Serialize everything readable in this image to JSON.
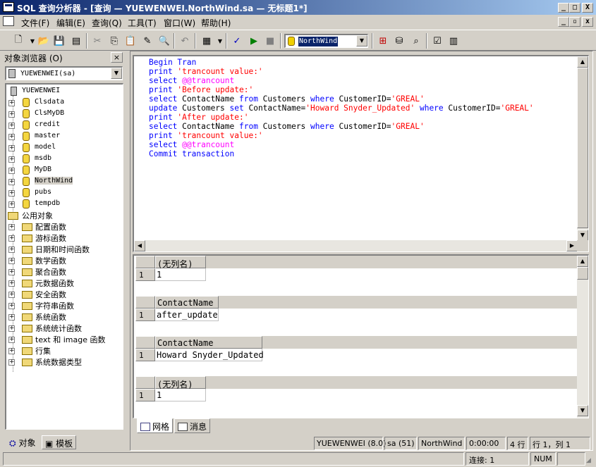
{
  "window": {
    "title": "SQL 查询分析器 - [查询 — YUEWENWEI.NorthWind.sa — 无标题1*]",
    "minimize": "_",
    "maximize": "□",
    "close": "X"
  },
  "menu": {
    "items": [
      "文件(F)",
      "编辑(E)",
      "查询(Q)",
      "工具(T)",
      "窗口(W)",
      "帮助(H)"
    ]
  },
  "toolbar": {
    "database": "NorthWind",
    "icons": [
      "new-query-icon",
      "open-icon",
      "save-icon",
      "load-script-icon",
      "cut-icon",
      "copy-icon",
      "paste-icon",
      "clear-icon",
      "find-icon",
      "undo-icon",
      "results-mode-icon",
      "parse-icon",
      "execute-icon",
      "cancel-icon",
      "database-icon",
      "object-browser-icon",
      "object-search-icon",
      "show-plan-icon",
      "options-icon",
      "results-pane-icon"
    ]
  },
  "object_browser": {
    "title": "对象浏览器 (O)",
    "close": "×",
    "server_selector": "YUEWENWEI(sa)",
    "server": "YUEWENWEI",
    "databases": [
      "Clsdata",
      "ClsMyDB",
      "credit",
      "master",
      "model",
      "msdb",
      "MyDB",
      "NorthWind",
      "pubs",
      "tempdb"
    ],
    "selected_database": "NorthWind",
    "common_objects": {
      "label": "公用对象",
      "items": [
        "配置函数",
        "游标函数",
        "日期和时间函数",
        "数学函数",
        "聚合函数",
        "元数据函数",
        "安全函数",
        "字符串函数",
        "系统函数",
        "系统统计函数",
        "text 和 image 函数",
        "行集",
        "系统数据类型"
      ]
    },
    "tabs": [
      "对象",
      "模板"
    ]
  },
  "editor": {
    "lines": [
      "Begin Tran",
      "print 'trancount value:'",
      "select @@trancount",
      "print 'Before update:'",
      "select ContactName from Customers where CustomerID='GREAL'",
      "update Customers set ContactName='Howard Snyder_Updated' where CustomerID='GREAL'",
      "print 'After update:'",
      "select ContactName from Customers where CustomerID='GREAL'",
      "print 'trancount value:'",
      "select @@trancount",
      "Commit transaction"
    ]
  },
  "results": [
    {
      "column": "(无列名)",
      "row_num": "1",
      "value": "1"
    },
    {
      "column": "ContactName",
      "row_num": "1",
      "value": "after_update"
    },
    {
      "column": "ContactName",
      "row_num": "1",
      "value": "Howard Snyder_Updated"
    },
    {
      "column": "(无列名)",
      "row_num": "1",
      "value": "1"
    }
  ],
  "result_tabs": [
    "网格",
    "消息"
  ],
  "query_status": {
    "server": "YUEWENWEI (8.0)",
    "user": "sa (51)",
    "database": "NorthWind",
    "elapsed": "0:00:00",
    "rows": "4 行",
    "position": "行 1，列 1"
  },
  "statusbar": {
    "connections": "连接: 1",
    "num": "NUM"
  }
}
